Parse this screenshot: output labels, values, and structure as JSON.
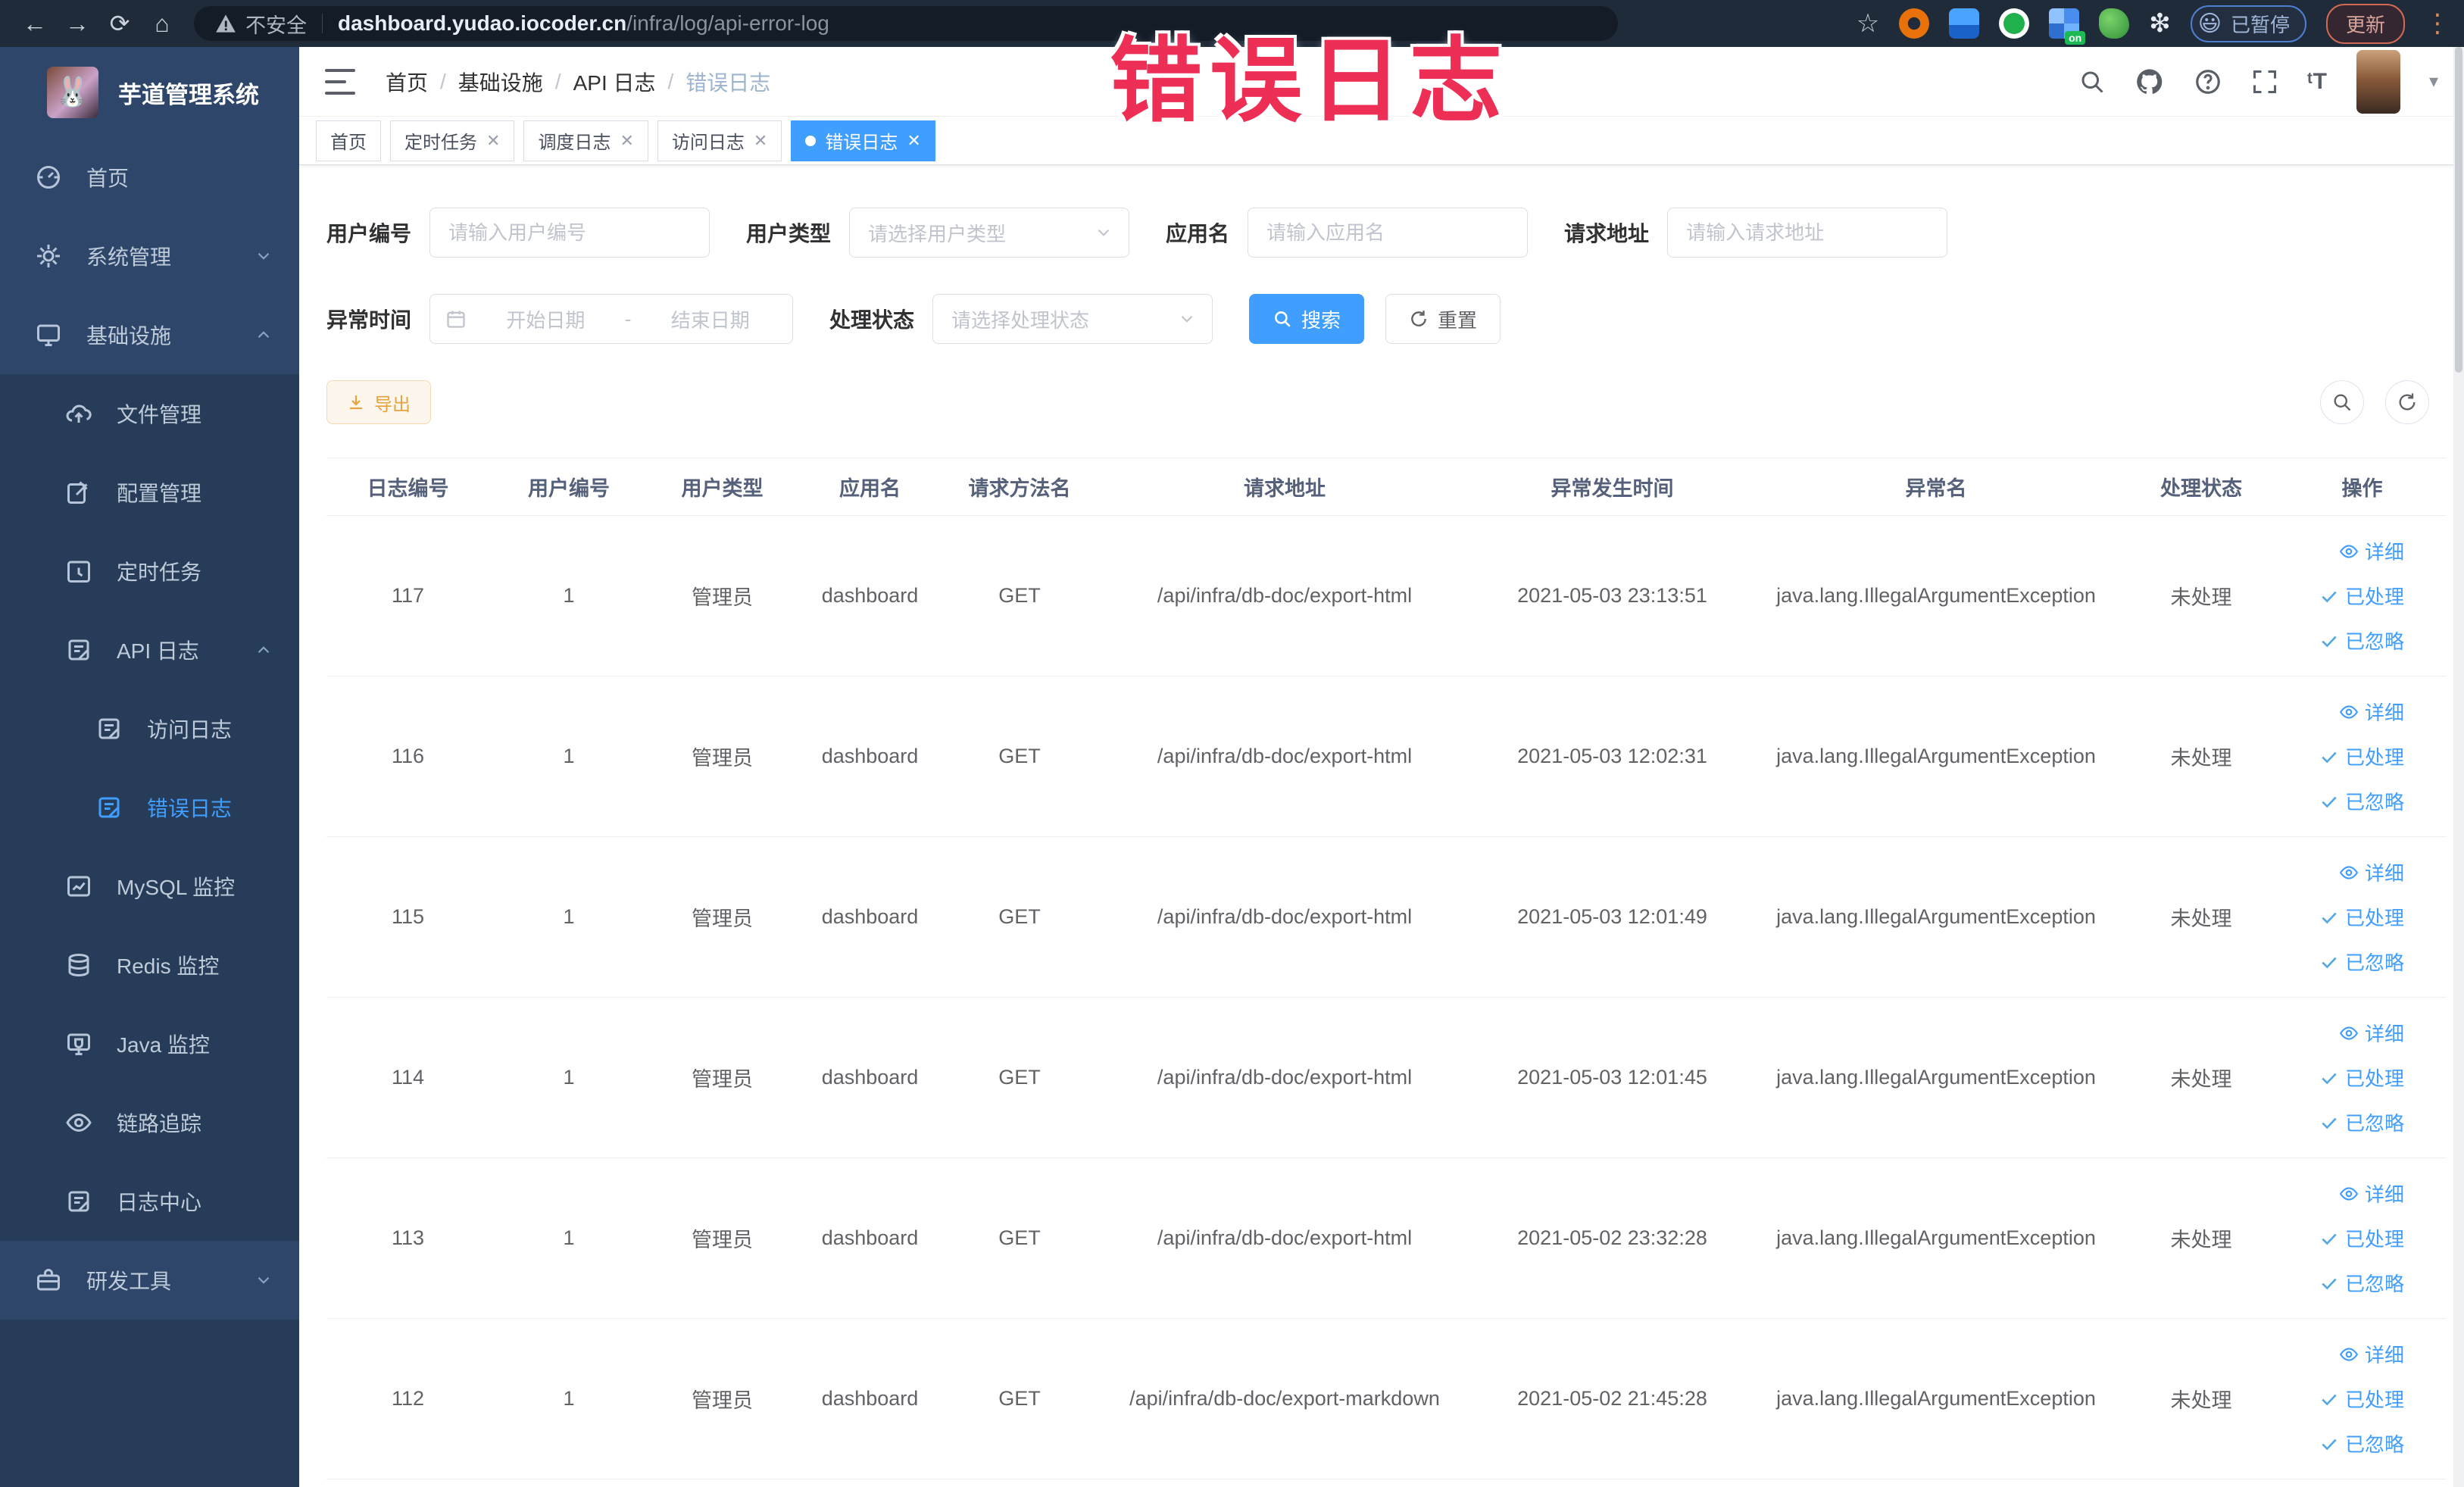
{
  "browser": {
    "security_label": "不安全",
    "url_domain": "dashboard.yudao.iocoder.cn",
    "url_path": "/infra/log/api-error-log",
    "paused_badge": "已暂停",
    "update_button": "更新"
  },
  "annotation": {
    "text": "错误日志"
  },
  "sidebar": {
    "logo_title": "芋道管理系统",
    "items": [
      {
        "label": "首页"
      },
      {
        "label": "系统管理"
      },
      {
        "label": "基础设施"
      },
      {
        "label": "文件管理"
      },
      {
        "label": "配置管理"
      },
      {
        "label": "定时任务"
      },
      {
        "label": "API 日志"
      },
      {
        "label": "访问日志"
      },
      {
        "label": "错误日志"
      },
      {
        "label": "MySQL 监控"
      },
      {
        "label": "Redis 监控"
      },
      {
        "label": "Java 监控"
      },
      {
        "label": "链路追踪"
      },
      {
        "label": "日志中心"
      },
      {
        "label": "研发工具"
      }
    ]
  },
  "header": {
    "breadcrumb": [
      "首页",
      "基础设施",
      "API 日志",
      "错误日志"
    ]
  },
  "tabs": [
    {
      "label": "首页"
    },
    {
      "label": "定时任务"
    },
    {
      "label": "调度日志"
    },
    {
      "label": "访问日志"
    },
    {
      "label": "错误日志"
    }
  ],
  "filters": {
    "user_id": {
      "label": "用户编号",
      "placeholder": "请输入用户编号"
    },
    "user_type": {
      "label": "用户类型",
      "placeholder": "请选择用户类型"
    },
    "app_name": {
      "label": "应用名",
      "placeholder": "请输入应用名"
    },
    "request_url": {
      "label": "请求地址",
      "placeholder": "请输入请求地址"
    },
    "exception_time": {
      "label": "异常时间",
      "start_placeholder": "开始日期",
      "separator": "-",
      "end_placeholder": "结束日期"
    },
    "process_status": {
      "label": "处理状态",
      "placeholder": "请选择处理状态"
    },
    "search_button": "搜索",
    "reset_button": "重置"
  },
  "toolbar": {
    "export_button": "导出"
  },
  "table": {
    "columns": [
      "日志编号",
      "用户编号",
      "用户类型",
      "应用名",
      "请求方法名",
      "请求地址",
      "异常发生时间",
      "异常名",
      "处理状态",
      "操作"
    ],
    "row_actions": [
      "详细",
      "已处理",
      "已忽略"
    ],
    "rows": [
      {
        "id": "117",
        "user_id": "1",
        "user_type": "管理员",
        "app": "dashboard",
        "method": "GET",
        "url": "/api/infra/db-doc/export-html",
        "time": "2021-05-03 23:13:51",
        "exception": "java.lang.IllegalArgumentException",
        "status": "未处理"
      },
      {
        "id": "116",
        "user_id": "1",
        "user_type": "管理员",
        "app": "dashboard",
        "method": "GET",
        "url": "/api/infra/db-doc/export-html",
        "time": "2021-05-03 12:02:31",
        "exception": "java.lang.IllegalArgumentException",
        "status": "未处理"
      },
      {
        "id": "115",
        "user_id": "1",
        "user_type": "管理员",
        "app": "dashboard",
        "method": "GET",
        "url": "/api/infra/db-doc/export-html",
        "time": "2021-05-03 12:01:49",
        "exception": "java.lang.IllegalArgumentException",
        "status": "未处理"
      },
      {
        "id": "114",
        "user_id": "1",
        "user_type": "管理员",
        "app": "dashboard",
        "method": "GET",
        "url": "/api/infra/db-doc/export-html",
        "time": "2021-05-03 12:01:45",
        "exception": "java.lang.IllegalArgumentException",
        "status": "未处理"
      },
      {
        "id": "113",
        "user_id": "1",
        "user_type": "管理员",
        "app": "dashboard",
        "method": "GET",
        "url": "/api/infra/db-doc/export-html",
        "time": "2021-05-02 23:32:28",
        "exception": "java.lang.IllegalArgumentException",
        "status": "未处理"
      },
      {
        "id": "112",
        "user_id": "1",
        "user_type": "管理员",
        "app": "dashboard",
        "method": "GET",
        "url": "/api/infra/db-doc/export-markdown",
        "time": "2021-05-02 21:45:28",
        "exception": "java.lang.IllegalArgumentException",
        "status": "未处理"
      }
    ]
  },
  "icons": {
    "browser": [
      "back-arrow",
      "forward-arrow",
      "reload",
      "home",
      "warning-triangle",
      "bookmark-star",
      "extensions",
      "browser-menu"
    ],
    "header": [
      "search",
      "github",
      "help",
      "fullscreen",
      "font-size",
      "avatar",
      "caret-down"
    ],
    "actions": [
      "eye",
      "check"
    ]
  },
  "colors": {
    "primary": "#409eff",
    "sidebar_bg": "#2d4669",
    "sidebar_submenu_bg": "#263c59",
    "chrome_bg": "#202b3a",
    "annotation_red": "#ee2f55",
    "export_orange": "#e6a23c",
    "active_menu_text": "#409eff"
  }
}
